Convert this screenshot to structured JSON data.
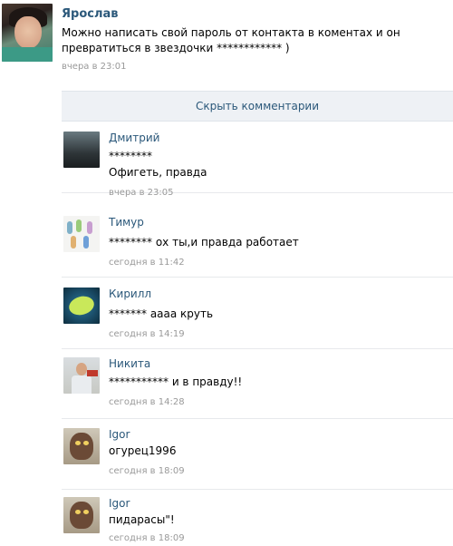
{
  "post": {
    "author": "Ярослав",
    "text": "Можно написать свой пароль от контакта в коментах и он превратиться в звездочки ************ )",
    "time": "вчера в 23:01"
  },
  "hide_comments_label": "Скрыть комментарии",
  "comments": [
    {
      "author": "Дмитрий",
      "line1": "********",
      "line2": "Офигеть, правда",
      "time": "вчера в 23:05"
    },
    {
      "author": "Тимур",
      "text": "******** ох ты,и правда работает",
      "time": "сегодня в 11:42"
    },
    {
      "author": "Кирилл",
      "text": "******* аааа круть",
      "time": "сегодня в 14:19"
    },
    {
      "author": "Никита",
      "text": "*********** и в правду!!",
      "time": "сегодня в 14:28"
    },
    {
      "author": "Igor",
      "text": "огурец1996",
      "time": "сегодня в 18:09"
    },
    {
      "author": "Igor",
      "text": "пидарасы\"!",
      "time": "сегодня в 18:09"
    }
  ]
}
